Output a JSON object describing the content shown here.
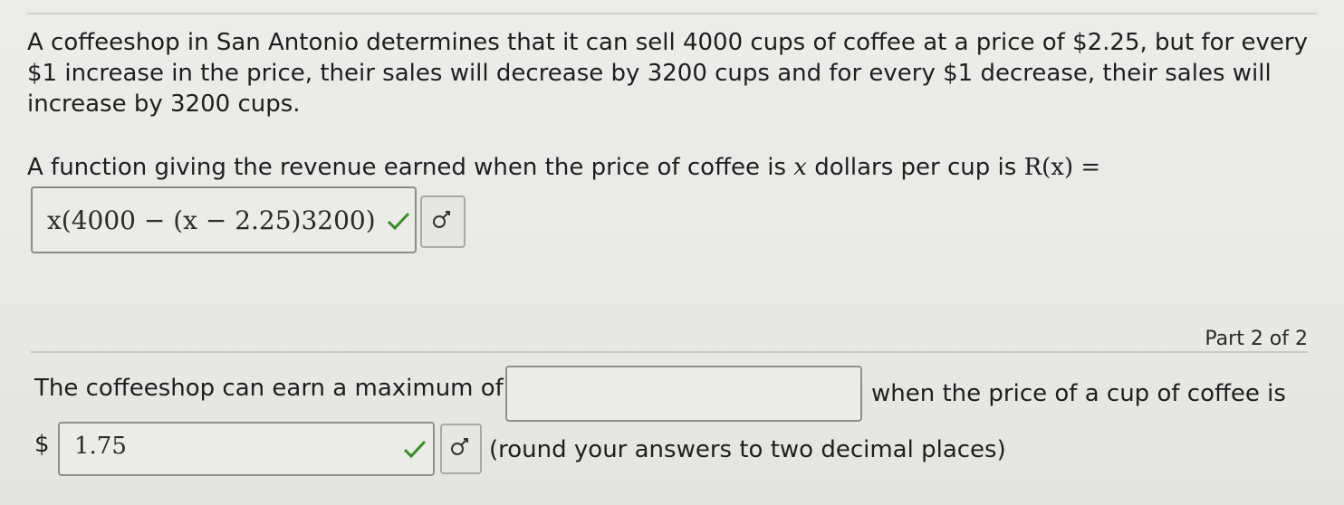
{
  "question": {
    "intro": "A coffeeshop in San Antonio determines that it can sell 4000 cups of coffee at a price of $2.25, but for every $1 increase in the price, their sales will decrease by 3200 cups and for every $1 decrease, their sales will increase by 3200 cups.",
    "part1_prompt_before": "A function giving the revenue earned when the price of coffee is",
    "part1_var": "x",
    "part1_prompt_after": "dollars per cup is",
    "part1_func": "R(x) =",
    "part1_answer": "x(4000 − (x − 2.25)3200)"
  },
  "part2": {
    "label": "Part 2 of 2",
    "text_before": "The coffeeshop can earn a maximum of",
    "max_value": "",
    "text_after": "when the price of a cup of coffee is",
    "currency": "$",
    "price_value": "1.75",
    "note": "(round your answers to two decimal places)"
  },
  "icons": {
    "check": "checkmark-icon",
    "tool": "math-editor-icon"
  },
  "colors": {
    "check": "#3a8a2a",
    "border": "#8f8f8b"
  }
}
